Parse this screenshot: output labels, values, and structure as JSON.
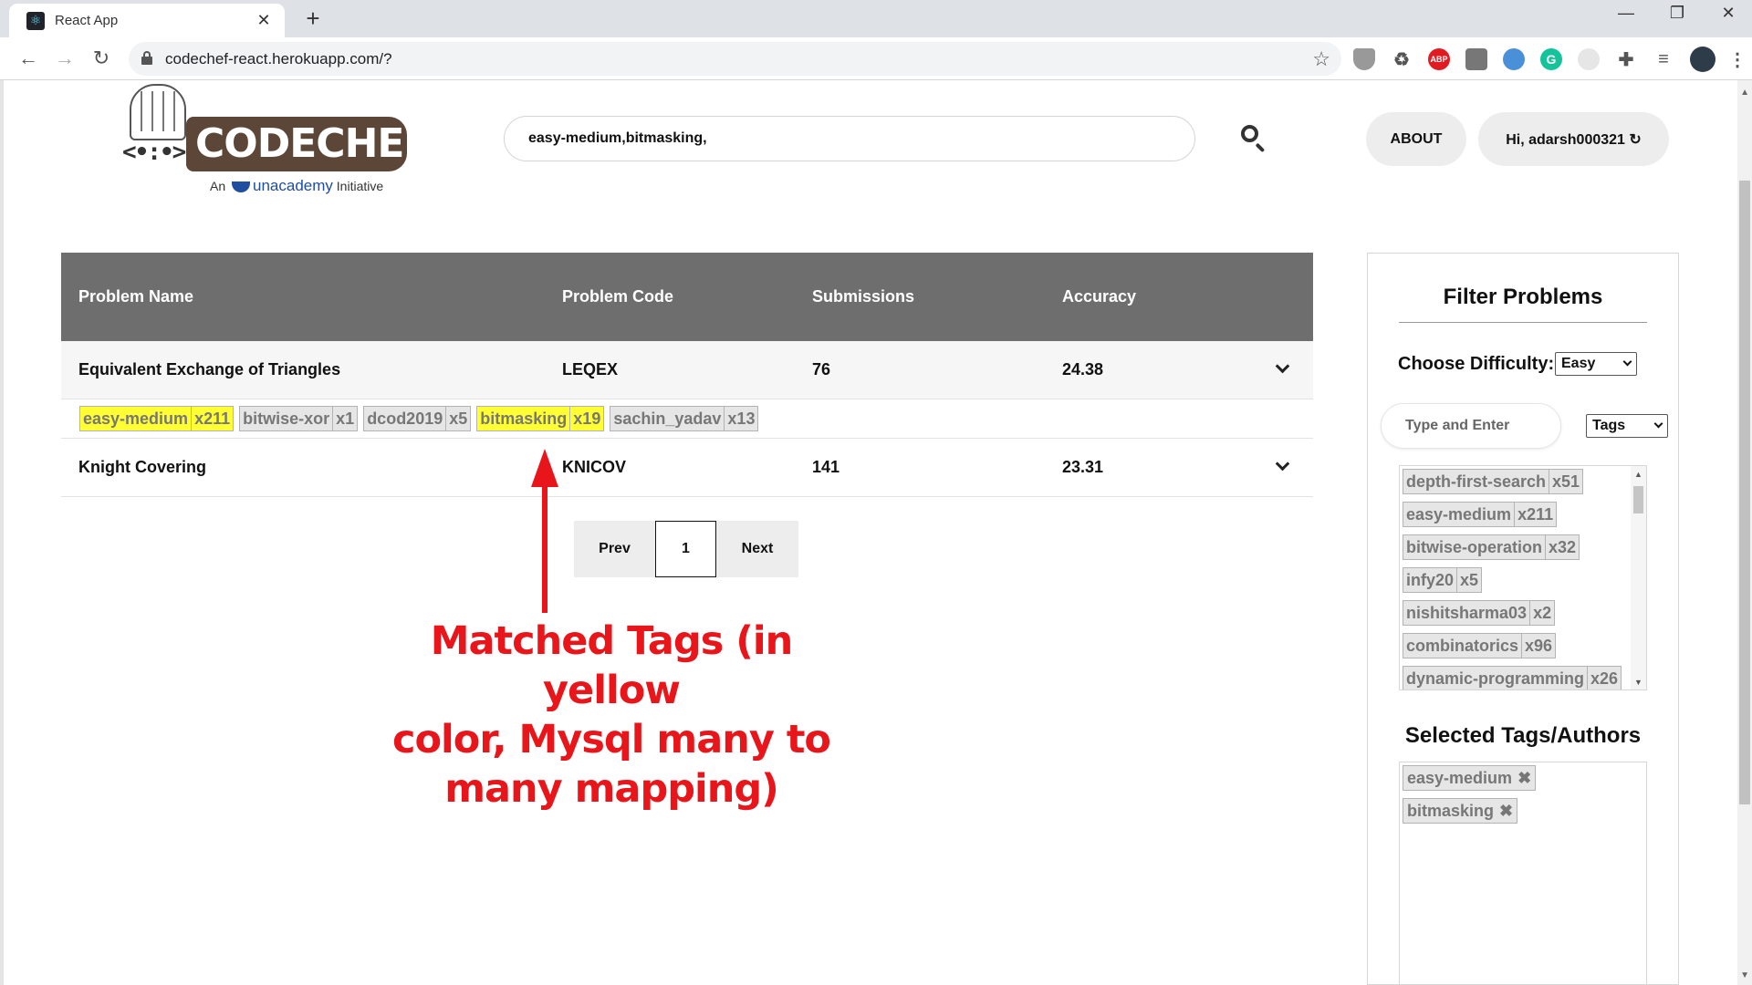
{
  "browser": {
    "tab_title": "React App",
    "tab_favicon": "react-logo",
    "url": "codechef-react.herokuapp.com/?"
  },
  "header": {
    "logo_word": "CODECHEF",
    "logo_sub_prefix": "An",
    "logo_sub_brand": "unacademy",
    "logo_sub_suffix": "Initiative",
    "search_value": "easy-medium,bitmasking,",
    "about_label": "ABOUT",
    "user_label": "Hi, adarsh000321 ↻"
  },
  "table": {
    "columns": [
      "Problem Name",
      "Problem Code",
      "Submissions",
      "Accuracy"
    ],
    "rows": [
      {
        "name": "Equivalent Exchange of Triangles",
        "code": "LEQEX",
        "submissions": "76",
        "accuracy": "24.38",
        "expanded": true,
        "tags": [
          {
            "name": "easy-medium",
            "count": "x211",
            "matched": true
          },
          {
            "name": "bitwise-xor",
            "count": "x1",
            "matched": false
          },
          {
            "name": "dcod2019",
            "count": "x5",
            "matched": false
          },
          {
            "name": "bitmasking",
            "count": "x19",
            "matched": true
          },
          {
            "name": "sachin_yadav",
            "count": "x13",
            "matched": false
          }
        ]
      },
      {
        "name": "Knight Covering",
        "code": "KNICOV",
        "submissions": "141",
        "accuracy": "23.31",
        "expanded": false
      }
    ]
  },
  "pagination": {
    "prev_label": "Prev",
    "current_page": "1",
    "next_label": "Next"
  },
  "annotation": {
    "text_line1": "Matched Tags (in yellow",
    "text_line2": "color, Mysql many to",
    "text_line3": "many mapping)",
    "color": "#e8161a"
  },
  "filter": {
    "title": "Filter Problems",
    "difficulty_label": "Choose Difficulty:",
    "difficulty_value": "Easy",
    "tag_input_placeholder": "Type and Enter",
    "tag_type_value": "Tags",
    "available_tags": [
      {
        "name": "depth-first-search",
        "count": "x51"
      },
      {
        "name": "easy-medium",
        "count": "x211"
      },
      {
        "name": "bitwise-operation",
        "count": "x32"
      },
      {
        "name": "infy20",
        "count": "x5"
      },
      {
        "name": "nishitsharma03",
        "count": "x2"
      },
      {
        "name": "combinatorics",
        "count": "x96"
      },
      {
        "name": "dynamic-programming",
        "count": "x26"
      }
    ],
    "selected_title": "Selected Tags/Authors",
    "selected_tags": [
      "easy-medium",
      "bitmasking"
    ]
  },
  "colors": {
    "table_header_bg": "#6e6e6e",
    "matched_tag_bg": "#ffff33",
    "tag_bg": "#e6e6e6",
    "brand_brown": "#5b4638"
  }
}
